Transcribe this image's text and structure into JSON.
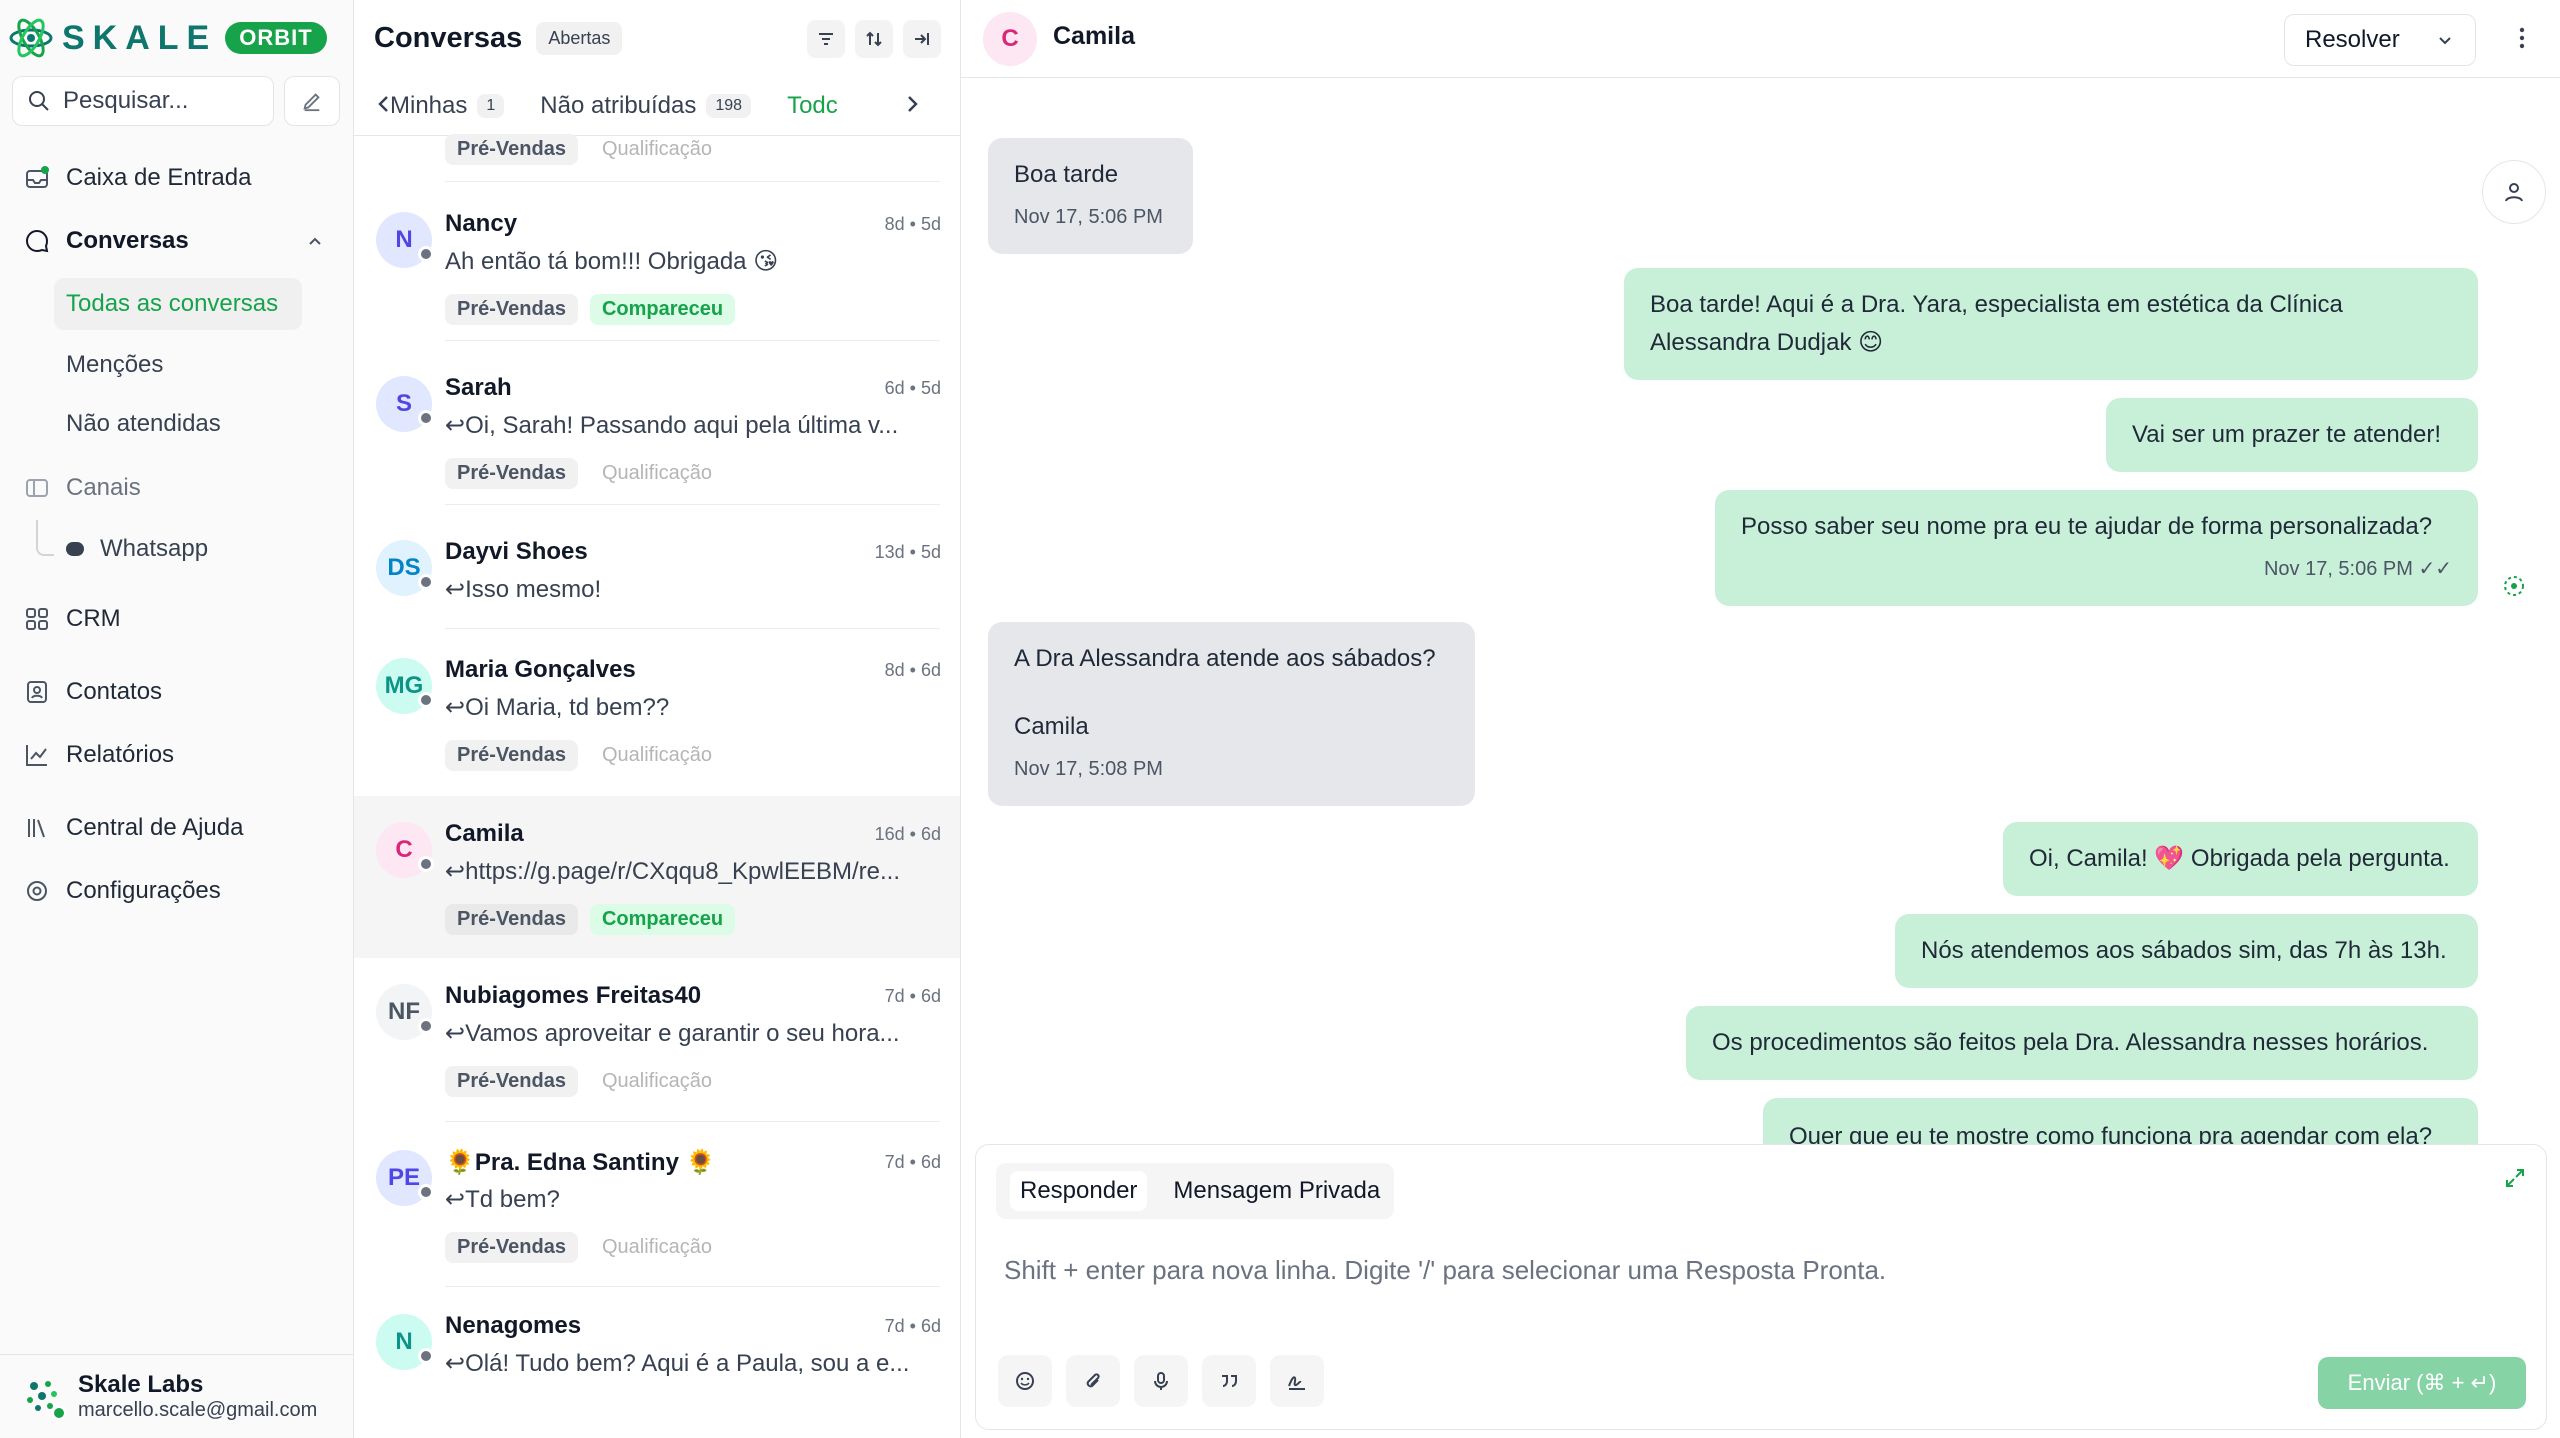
{
  "brand": {
    "name": "SKALE",
    "badge": "ORBIT"
  },
  "sidebar": {
    "search_placeholder": "Pesquisar...",
    "items": [
      {
        "label": "Caixa de Entrada",
        "icon": "inbox-icon"
      },
      {
        "label": "Conversas",
        "icon": "chat-icon"
      },
      {
        "label": "Canais",
        "icon": "channels-icon"
      },
      {
        "label": "CRM",
        "icon": "grid-icon"
      },
      {
        "label": "Contatos",
        "icon": "contacts-icon"
      },
      {
        "label": "Relatórios",
        "icon": "chart-icon"
      },
      {
        "label": "Central de Ajuda",
        "icon": "library-icon"
      },
      {
        "label": "Configurações",
        "icon": "gear-icon"
      }
    ],
    "conversas_sub": [
      "Todas as conversas",
      "Menções",
      "Não atendidas"
    ],
    "channel": "Whatsapp",
    "user": {
      "name": "Skale Labs",
      "email": "marcello.scale@gmail.com"
    }
  },
  "list": {
    "title": "Conversas",
    "status": "Abertas",
    "tabs": [
      {
        "label": "Minhas",
        "count": "1"
      },
      {
        "label": "Não atribuídas",
        "count": "198"
      },
      {
        "label": "Todc",
        "count": ""
      }
    ],
    "top_tags": [
      "Pré-Vendas",
      "Qualificação"
    ],
    "conversations": [
      {
        "initials": "N",
        "name": "Nancy",
        "time": "8d • 5d",
        "message": "Ah então tá bom!!! Obrigada 😘",
        "tags": [
          "Pré-Vendas",
          "Compareceu"
        ]
      },
      {
        "initials": "S",
        "name": "Sarah",
        "time": "6d • 5d",
        "message": "↩Oi, Sarah! Passando aqui pela última v...",
        "tags": [
          "Pré-Vendas",
          "Qualificação"
        ]
      },
      {
        "initials": "DS",
        "name": "Dayvi Shoes",
        "time": "13d • 5d",
        "message": "↩Isso mesmo!",
        "tags": []
      },
      {
        "initials": "MG",
        "name": "Maria Gonçalves",
        "time": "8d • 6d",
        "message": "↩Oi Maria, td bem??",
        "tags": [
          "Pré-Vendas",
          "Qualificação"
        ]
      },
      {
        "initials": "C",
        "name": "Camila",
        "time": "16d • 6d",
        "message": "↩https://g.page/r/CXqqu8_KpwlEEBM/re...",
        "tags": [
          "Pré-Vendas",
          "Compareceu"
        ]
      },
      {
        "initials": "NF",
        "name": "Nubiagomes Freitas40",
        "time": "7d • 6d",
        "message": "↩Vamos aproveitar e garantir o seu hora...",
        "tags": [
          "Pré-Vendas",
          "Qualificação"
        ]
      },
      {
        "initials": "PE",
        "name": "🌻Pra. Edna Santiny 🌻",
        "time": "7d • 6d",
        "message": "↩Td bem?",
        "tags": [
          "Pré-Vendas",
          "Qualificação"
        ]
      },
      {
        "initials": "N",
        "name": "Nenagomes",
        "time": "7d • 6d",
        "message": "↩Olá! Tudo bem? Aqui é a Paula, sou a e...",
        "tags": []
      }
    ]
  },
  "chat": {
    "contact_initial": "C",
    "contact_name": "Camila",
    "resolve_label": "Resolver",
    "messages": [
      {
        "dir": "in",
        "text": "Boa tarde",
        "time": "Nov 17, 5:06 PM"
      },
      {
        "dir": "out",
        "text": "Boa tarde! Aqui é a Dra. Yara, especialista em estética da Clínica Alessandra Dudjak 😊",
        "time": ""
      },
      {
        "dir": "out",
        "text": "Vai ser um prazer te atender!",
        "time": ""
      },
      {
        "dir": "out",
        "text": "Posso saber seu nome pra eu te ajudar de forma personalizada?",
        "time": "Nov 17, 5:06 PM ✓✓"
      },
      {
        "dir": "in",
        "text": "A Dra Alessandra atende aos sábados?",
        "text2": "Camila",
        "time": "Nov 17, 5:08 PM"
      },
      {
        "dir": "out",
        "text": "Oi, Camila! 💖 Obrigada pela pergunta.",
        "time": ""
      },
      {
        "dir": "out",
        "text": "Nós atendemos aos sábados sim, das 7h às 13h.",
        "time": ""
      },
      {
        "dir": "out",
        "text": "Os procedimentos são feitos pela Dra. Alessandra nesses horários.",
        "time": ""
      },
      {
        "dir": "out",
        "text": "Quer que eu te mostre como funciona pra agendar com ela?",
        "time": ""
      }
    ],
    "composer": {
      "tab_reply": "Responder",
      "tab_private": "Mensagem Privada",
      "placeholder": "Shift + enter para nova linha. Digite '/' para selecionar uma Resposta Pronta.",
      "send_label": "Enviar (⌘ + ↵)"
    }
  },
  "colors": {
    "accent": "#16a34a",
    "bubble_out": "#c8f0d8",
    "bubble_in": "#e5e7eb"
  }
}
